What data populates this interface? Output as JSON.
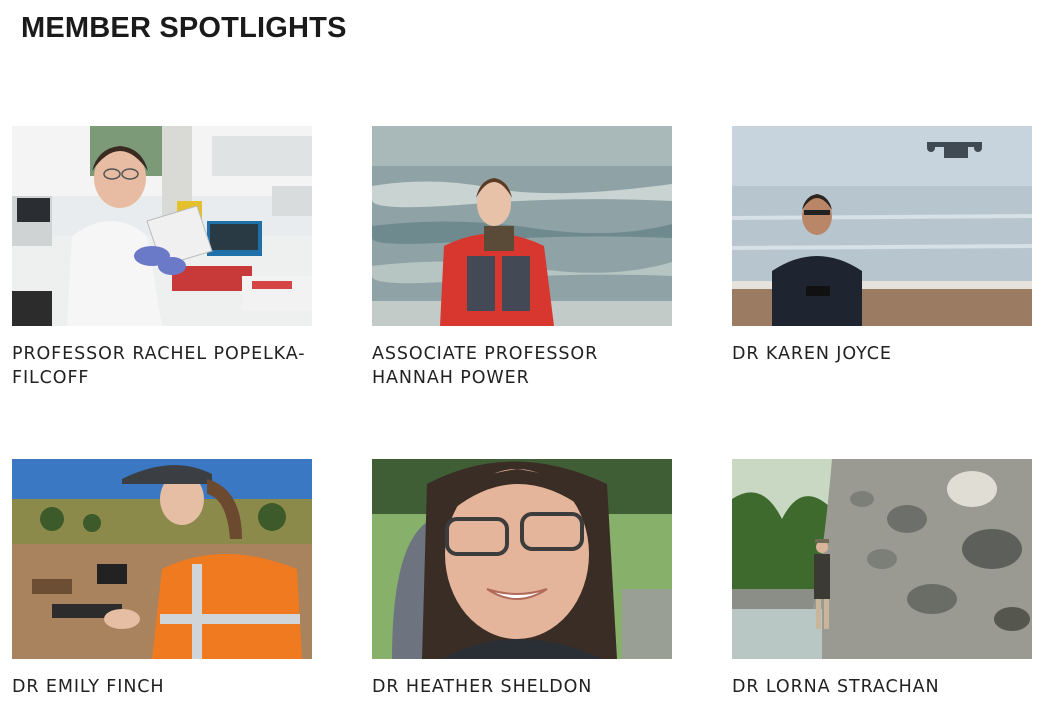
{
  "page": {
    "title": "MEMBER SPOTLIGHTS"
  },
  "members": [
    {
      "name": "PROFESSOR RACHEL POPELKA-FILCOFF"
    },
    {
      "name": "ASSOCIATE PROFESSOR HANNAH POWER"
    },
    {
      "name": "DR KAREN JOYCE"
    },
    {
      "name": "DR EMILY FINCH"
    },
    {
      "name": "DR HEATHER SHELDON"
    },
    {
      "name": "DR LORNA STRACHAN"
    }
  ],
  "colors": {
    "background": "#ffffff",
    "text": "#1c1c1c"
  }
}
